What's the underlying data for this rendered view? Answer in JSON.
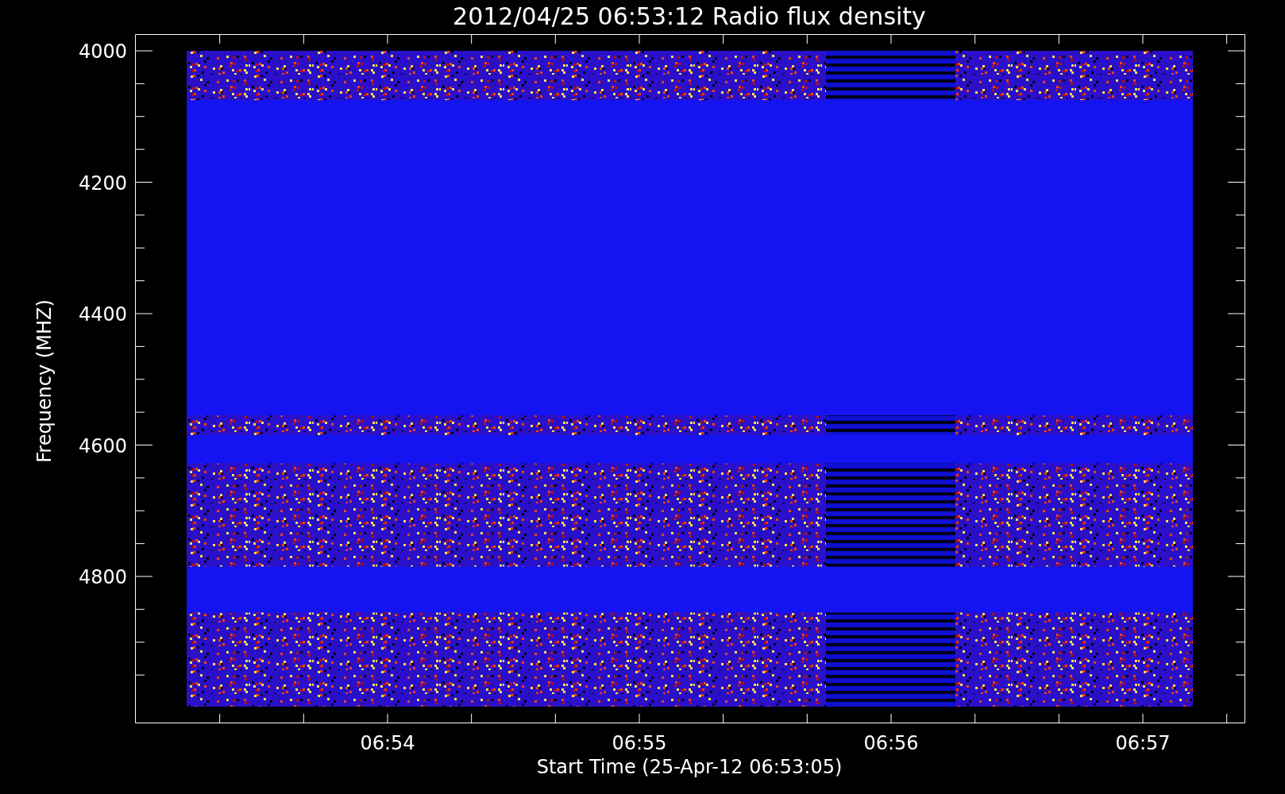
{
  "title": "2012/04/25 06:53:12 Radio flux density",
  "y_axis": {
    "label": "Frequency (MHZ)",
    "ticks": [
      "4000",
      "4200",
      "4400",
      "4600",
      "4800"
    ]
  },
  "x_axis": {
    "label": "Start Time (25-Apr-12 06:53:05)",
    "ticks": [
      "06:54",
      "06:55",
      "06:56",
      "06:57"
    ]
  }
}
